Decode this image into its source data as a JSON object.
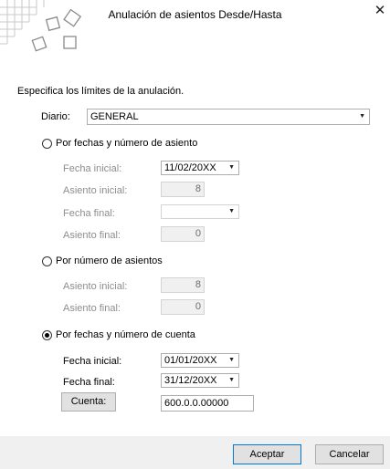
{
  "window": {
    "title": "Anulación de asientos Desde/Hasta",
    "close_icon": "close-icon"
  },
  "heading": "Especifica los límites de la anulación.",
  "diario": {
    "label": "Diario:",
    "value": "GENERAL"
  },
  "option_fechas_asiento": {
    "label": "Por fechas y número de asiento",
    "selected": false,
    "fecha_inicial_label": "Fecha inicial:",
    "fecha_inicial_value": "11/02/20XX",
    "asiento_inicial_label": "Asiento inicial:",
    "asiento_inicial_value": "8",
    "fecha_final_label": "Fecha final:",
    "fecha_final_value": "",
    "asiento_final_label": "Asiento final:",
    "asiento_final_value": "0"
  },
  "option_numero_asientos": {
    "label": "Por número de asientos",
    "selected": false,
    "asiento_inicial_label": "Asiento inicial:",
    "asiento_inicial_value": "8",
    "asiento_final_label": "Asiento final:",
    "asiento_final_value": "0"
  },
  "option_fechas_cuenta": {
    "label": "Por fechas y número de cuenta",
    "selected": true,
    "fecha_inicial_label": "Fecha inicial:",
    "fecha_inicial_value": "01/01/20XX",
    "fecha_final_label": "Fecha final:",
    "fecha_final_value": "31/12/20XX",
    "cuenta_button_label": "Cuenta:",
    "cuenta_value": "600.0.0.00000"
  },
  "footer": {
    "accept_label": "Aceptar",
    "cancel_label": "Cancelar"
  },
  "colors": {
    "accent": "#0078d7",
    "disabled_text": "#8d8d8d",
    "footer_bg": "#f0f0f0"
  }
}
